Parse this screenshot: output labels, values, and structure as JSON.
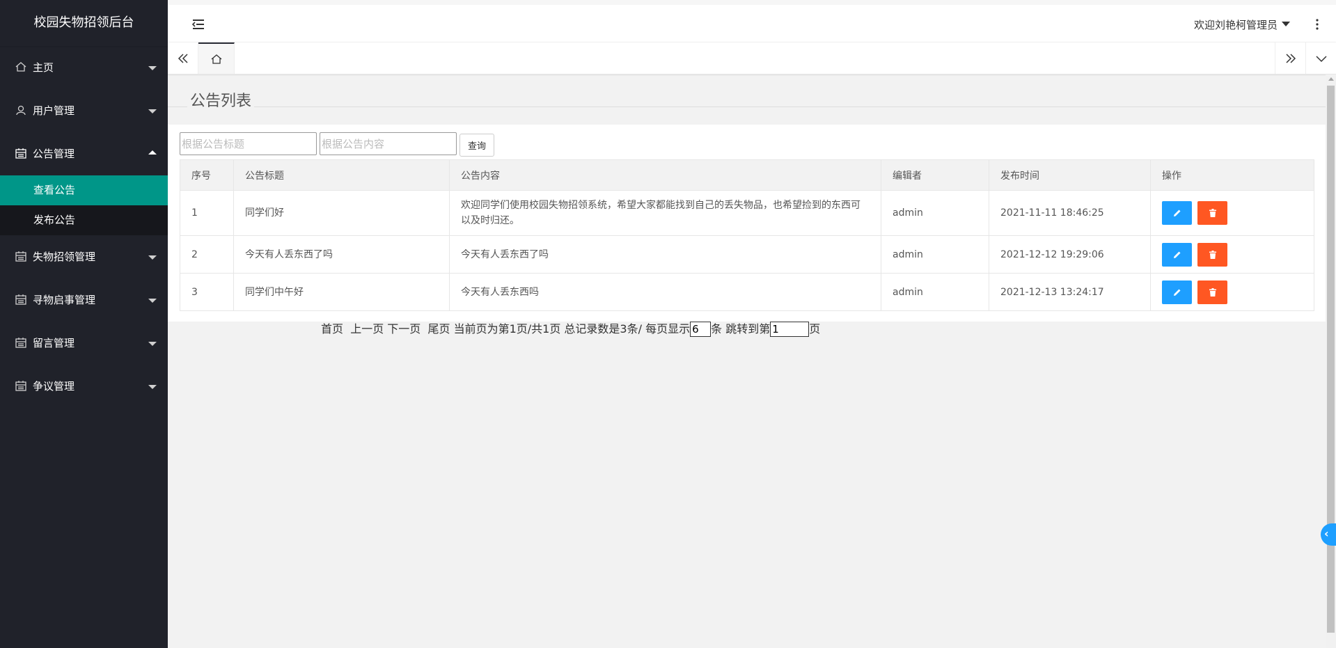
{
  "app": {
    "title": "校园失物招领后台"
  },
  "sidebar": {
    "items": [
      {
        "label": "主页",
        "icon": "home-icon",
        "expanded": false
      },
      {
        "label": "用户管理",
        "icon": "user-icon",
        "expanded": false
      },
      {
        "label": "公告管理",
        "icon": "calendar-icon",
        "expanded": true
      },
      {
        "label": "失物招领管理",
        "icon": "calendar-icon",
        "expanded": false
      },
      {
        "label": "寻物启事管理",
        "icon": "calendar-icon",
        "expanded": false
      },
      {
        "label": "留言管理",
        "icon": "calendar-icon",
        "expanded": false
      },
      {
        "label": "争议管理",
        "icon": "calendar-icon",
        "expanded": false
      }
    ],
    "subitems": [
      {
        "label": "查看公告",
        "active": true
      },
      {
        "label": "发布公告",
        "active": false
      }
    ]
  },
  "header": {
    "user_label": "欢迎刘艳柯管理员"
  },
  "page": {
    "title": "公告列表"
  },
  "search": {
    "title_placeholder": "根据公告标题",
    "content_placeholder": "根据公告内容",
    "button_label": "查询"
  },
  "table": {
    "columns": [
      "序号",
      "公告标题",
      "公告内容",
      "编辑者",
      "发布时间",
      "操作"
    ],
    "rows": [
      {
        "id": "1",
        "title": "同学们好",
        "content": "欢迎同学们使用校园失物招领系统，希望大家都能找到自己的丢失物品，也希望捡到的东西可以及时归还。",
        "editor": "admin",
        "time": "2021-11-11 18:46:25"
      },
      {
        "id": "2",
        "title": "今天有人丢东西了吗",
        "content": "今天有人丢东西了吗",
        "editor": "admin",
        "time": "2021-12-12 19:29:06"
      },
      {
        "id": "3",
        "title": "同学们中午好",
        "content": "今天有人丢东西吗",
        "editor": "admin",
        "time": "2021-12-13 13:24:17"
      }
    ]
  },
  "pager": {
    "first": "首页",
    "prev": "上一页",
    "next": "下一页",
    "last": "尾页",
    "info": "当前页为第1页/共1页 总记录数是3条/ 每页显示",
    "page_size": "6",
    "unit": "条",
    "jump_label": "跳转到第",
    "jump_value": "1",
    "page_suffix": "页"
  },
  "colors": {
    "sidebar_bg": "#20222a",
    "active_green": "#009688",
    "edit_blue": "#1e9fff",
    "delete_orange": "#ff5722"
  }
}
